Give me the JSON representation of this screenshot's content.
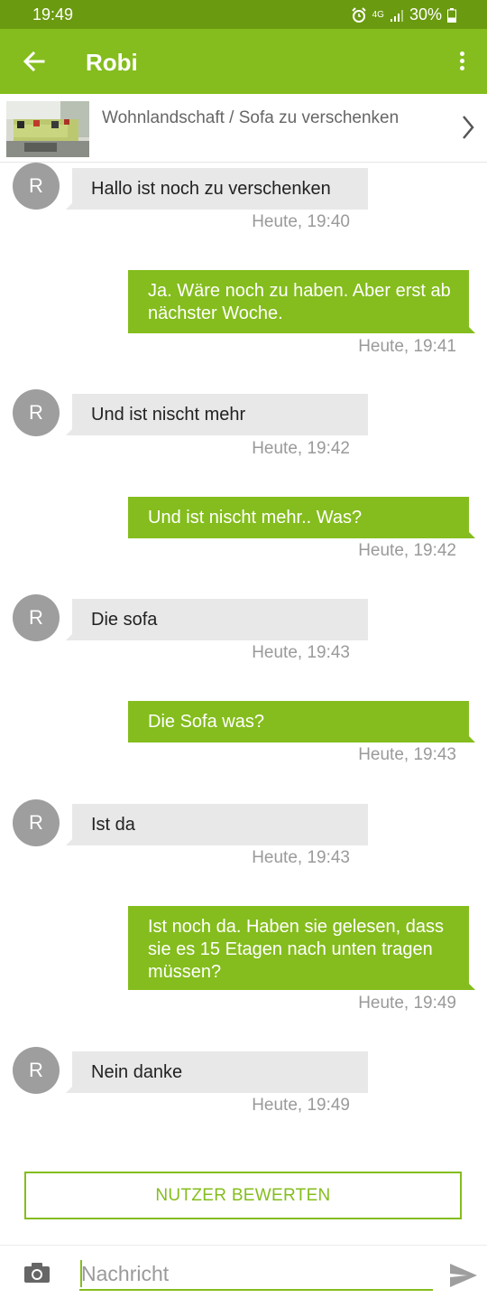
{
  "status_bar": {
    "time": "19:49",
    "network": "4G",
    "battery": "30%"
  },
  "header": {
    "title": "Robi"
  },
  "listing": {
    "title": "Wohnlandschaft / Sofa zu verschenken"
  },
  "messages": [
    {
      "direction": "in",
      "avatar": "R",
      "text": "Hallo ist noch zu verschenken",
      "time": "Heute, 19:40"
    },
    {
      "direction": "out",
      "text": "Ja. Wäre noch zu haben. Aber erst ab nächster Woche.",
      "time": "Heute, 19:41"
    },
    {
      "direction": "in",
      "avatar": "R",
      "text": "Und ist nischt mehr",
      "time": "Heute, 19:42"
    },
    {
      "direction": "out",
      "text": "Und ist nischt mehr.. Was?",
      "time": "Heute, 19:42"
    },
    {
      "direction": "in",
      "avatar": "R",
      "text": "Die sofa",
      "time": "Heute, 19:43"
    },
    {
      "direction": "out",
      "text": "Die Sofa was?",
      "time": "Heute, 19:43"
    },
    {
      "direction": "in",
      "avatar": "R",
      "text": "Ist da",
      "time": "Heute, 19:43"
    },
    {
      "direction": "out",
      "text": "Ist noch da. Haben sie gelesen, dass sie es 15 Etagen nach unten tragen müssen?",
      "time": "Heute, 19:49"
    },
    {
      "direction": "in",
      "avatar": "R",
      "text": "Nein danke",
      "time": "Heute, 19:49"
    }
  ],
  "actions": {
    "rate_user": "NUTZER BEWERTEN"
  },
  "composer": {
    "placeholder": "Nachricht"
  },
  "icons": {
    "back": "arrow-left-icon",
    "menu": "more-vert-icon",
    "chevron": "chevron-right-icon",
    "camera": "camera-icon",
    "send": "send-icon"
  },
  "colors": {
    "accent": "#84bd1d",
    "status_bar": "#6a9a0f",
    "incoming_bubble": "#e8e8e8",
    "avatar": "#9e9e9e"
  }
}
